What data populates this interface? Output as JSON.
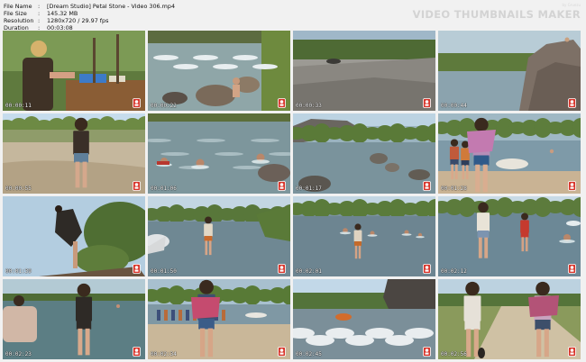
{
  "file_info": {
    "rows": [
      {
        "key": "File Name",
        "value": "[Dream Studio] Petal Stone - Video 306.mp4"
      },
      {
        "key": "File Size",
        "value": "145.32 MB"
      },
      {
        "key": "Resolution",
        "value": "1280x720 / 29.97 fps"
      },
      {
        "key": "Duration",
        "value": "00:03:08"
      }
    ],
    "separator": ":"
  },
  "brand": {
    "title": "VIDEO THUMBNAILS MAKER",
    "subtitle": "by Gruezu"
  },
  "thumbnails": [
    {
      "timestamp": "00:00:11",
      "scene": "picnic-table"
    },
    {
      "timestamp": "00:00:22",
      "scene": "rapids-rocks"
    },
    {
      "timestamp": "00:00:33",
      "scene": "rock-ledge"
    },
    {
      "timestamp": "00:00:44",
      "scene": "cliff-river"
    },
    {
      "timestamp": "00:00:55",
      "scene": "sandy-bank"
    },
    {
      "timestamp": "00:01:06",
      "scene": "swimmers"
    },
    {
      "timestamp": "00:01:17",
      "scene": "river-boulders"
    },
    {
      "timestamp": "00:01:28",
      "scene": "beach-group"
    },
    {
      "timestamp": "00:01:39",
      "scene": "climbing-tree"
    },
    {
      "timestamp": "00:01:50",
      "scene": "wading-river"
    },
    {
      "timestamp": "00:02:01",
      "scene": "wading-river-2"
    },
    {
      "timestamp": "00:02:12",
      "scene": "bikini-group"
    },
    {
      "timestamp": "00:02:23",
      "scene": "swim-bank"
    },
    {
      "timestamp": "00:02:34",
      "scene": "crowd-beach"
    },
    {
      "timestamp": "00:02:45",
      "scene": "waterfall"
    },
    {
      "timestamp": "00:02:56",
      "scene": "path-walk"
    }
  ]
}
